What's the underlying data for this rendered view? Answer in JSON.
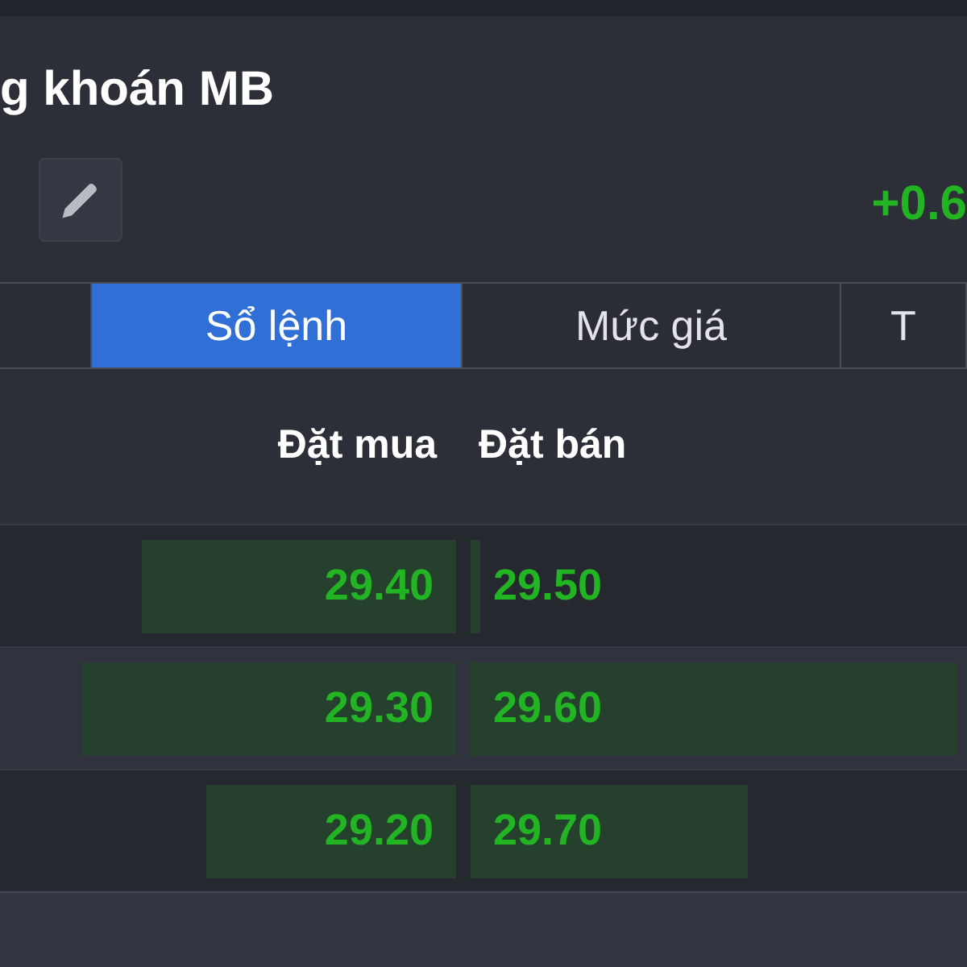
{
  "header": {
    "title": "g khoán MB",
    "change": "+0.6"
  },
  "tabs": [
    {
      "selected": false
    },
    {
      "label": "Sổ lệnh",
      "selected": true
    },
    {
      "label": "Mức giá",
      "selected": false
    },
    {
      "label": "T",
      "selected": false
    }
  ],
  "order_book": {
    "columns": [
      "Đặt mua",
      "Đặt bán"
    ],
    "rows": [
      {
        "bid": "29.40",
        "ask": "29.50"
      },
      {
        "bid": "29.30",
        "ask": "29.60"
      },
      {
        "bid": "29.20",
        "ask": "29.70"
      }
    ]
  }
}
